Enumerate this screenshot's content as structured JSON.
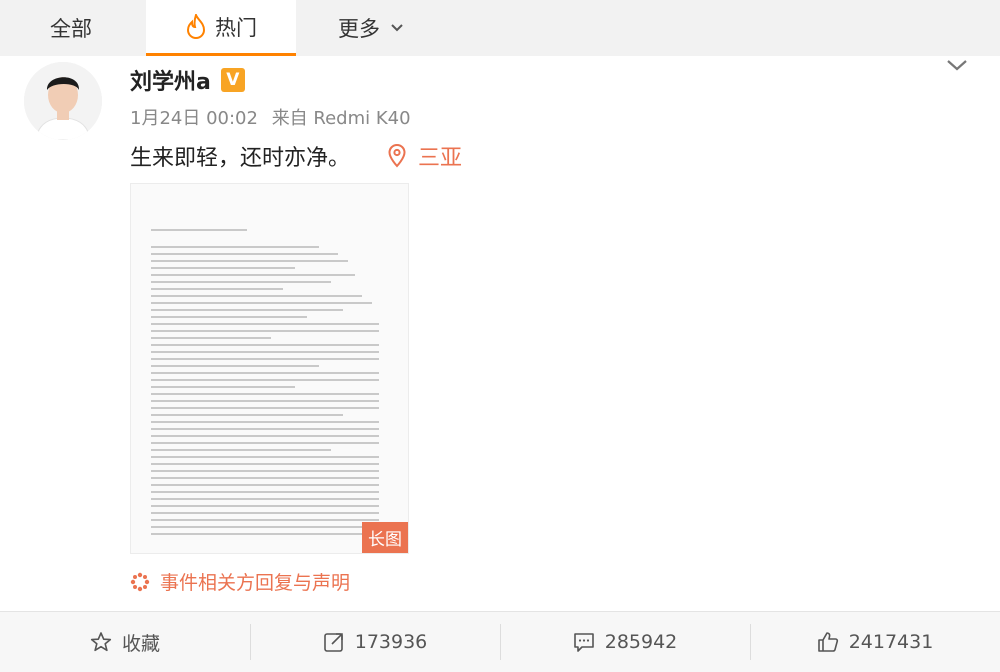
{
  "tabs": {
    "all": "全部",
    "hot": "热门",
    "more": "更多"
  },
  "post": {
    "username": "刘学州a",
    "verified_badge": "V",
    "date": "1月24日 00:02",
    "source": "来自 Redmi K40",
    "text": "生来即轻，还时亦净。",
    "location": "三亚",
    "image_badge": "长图",
    "topic": "事件相关方回复与声明"
  },
  "actions": {
    "favorite": "收藏",
    "repost": "173936",
    "comments": "285942",
    "likes": "2417431"
  },
  "colors": {
    "accent": "#eb7350",
    "tab_underline": "#ff8200",
    "verified": "#f8a424"
  },
  "icons": [
    "fire-icon",
    "chevron-down-icon",
    "location-pin-icon",
    "topic-icon",
    "star-icon",
    "repost-icon",
    "comment-icon",
    "like-icon"
  ]
}
